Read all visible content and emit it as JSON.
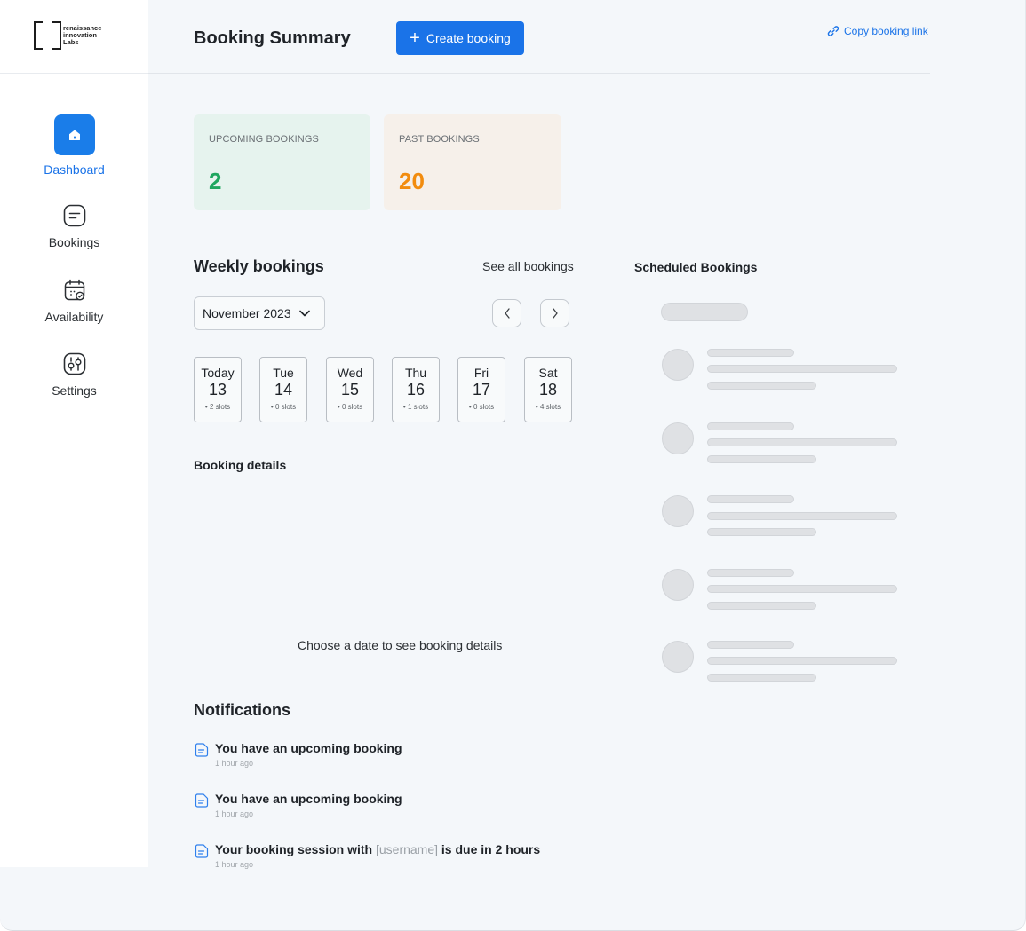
{
  "logo": {
    "line1": "renaissance",
    "line2": "innovation",
    "line3": "Labs"
  },
  "sidebar": {
    "items": [
      {
        "label": "Dashboard",
        "icon": "home-icon",
        "active": true
      },
      {
        "label": "Bookings",
        "icon": "bookings-icon",
        "active": false
      },
      {
        "label": "Availability",
        "icon": "calendar-icon",
        "active": false
      },
      {
        "label": "Settings",
        "icon": "settings-icon",
        "active": false
      }
    ]
  },
  "header": {
    "title": "Booking Summary",
    "create_label": "Create booking",
    "copy_link_label": "Copy booking link"
  },
  "stats": {
    "upcoming": {
      "label": "UPCOMING BOOKINGS",
      "value": "2"
    },
    "past": {
      "label": "PAST BOOKINGS",
      "value": "20"
    }
  },
  "weekly": {
    "title": "Weekly bookings",
    "see_all": "See all bookings",
    "month": "November 2023",
    "days": [
      {
        "name": "Today",
        "num": "13",
        "slots": "• 2 slots"
      },
      {
        "name": "Tue",
        "num": "14",
        "slots": "• 0 slots"
      },
      {
        "name": "Wed",
        "num": "15",
        "slots": "• 0 slots"
      },
      {
        "name": "Thu",
        "num": "16",
        "slots": "• 1 slots"
      },
      {
        "name": "Fri",
        "num": "17",
        "slots": "• 0 slots"
      },
      {
        "name": "Sat",
        "num": "18",
        "slots": "• 4 slots"
      }
    ]
  },
  "booking_details": {
    "title": "Booking details",
    "empty": "Choose a date to see booking details"
  },
  "scheduled": {
    "title": "Scheduled Bookings"
  },
  "notifications": {
    "title": "Notifications",
    "items": [
      {
        "text": "You have an upcoming booking",
        "time": "1 hour ago"
      },
      {
        "text": "You have an upcoming booking",
        "time": "1 hour ago"
      },
      {
        "text_before": "Your booking session with",
        "username": "[username]",
        "text_after": "is due in 2 hours",
        "time": "1 hour ago"
      }
    ]
  },
  "colors": {
    "primary": "#1a73e8",
    "upcoming_bg": "#e6f3ee",
    "upcoming_value": "#1fa65f",
    "past_bg": "#f6f0ea",
    "past_value": "#f28c0f"
  }
}
